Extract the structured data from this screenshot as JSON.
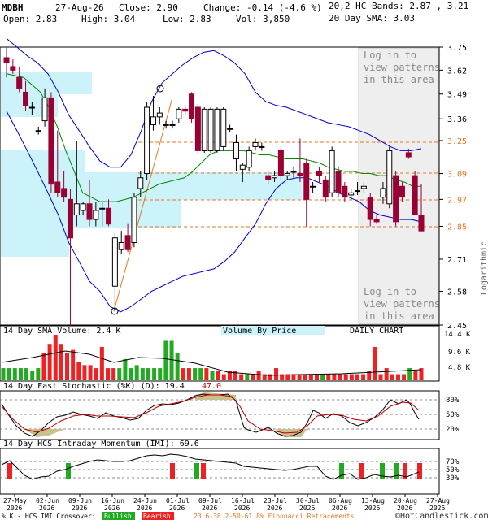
{
  "header": {
    "ticker": "MDBH",
    "date": "27-Aug-26",
    "close_label": "Close: 2.90",
    "change_label": "Change: -0.14 (-4.6 %)",
    "open_label": "Open: 2.83",
    "high_label": "High: 3.04",
    "low_label": "Low: 2.83",
    "vol_label": "Vol: 3,850",
    "bands_label": "20,2 HC Bands: 2.87 , 3.21",
    "sma_label": "20 Day SMA: 3.03",
    "bands_color": "#0000cc",
    "sma_color": "#008800"
  },
  "main_panel": {
    "patterns_note": [
      "Log in to",
      "view patterns",
      "in this area"
    ],
    "right_axis_title": "Logarithmic",
    "y_ticks": [
      "3.75",
      "3.62",
      "3.49",
      "3.36",
      "3.25",
      "3.09",
      "2.97",
      "2.85",
      "2.71",
      "2.58",
      "2.45"
    ],
    "highlight_ticks": [
      "3.25",
      "3.09",
      "2.97",
      "2.85"
    ],
    "fib_color": "#e87722"
  },
  "volume_panel": {
    "title": "14 Day SMA Volume: 2.4 K",
    "by_price_label": "Volume By Price",
    "daily_label": "DAILY CHART",
    "y_ticks": [
      "14.4 K",
      "9.6 K",
      "4.8 K"
    ]
  },
  "stoch_panel": {
    "title": "14 Day Fast Stochastic (%K) (D): 19.4",
    "d_value": "47.0",
    "y_ticks": [
      "80%",
      "50%",
      "20%"
    ]
  },
  "imi_panel": {
    "title": "14 Day HCS Intraday Momentum (IMI): 69.6",
    "y_ticks": [
      "70%",
      "50%",
      "30%"
    ]
  },
  "x_axis": {
    "labels": [
      [
        "27-May",
        "2026"
      ],
      [
        "02-Jun",
        "2026"
      ],
      [
        "09-Jun",
        "2026"
      ],
      [
        "16-Jun",
        "2026"
      ],
      [
        "24-Jun",
        "2026"
      ],
      [
        "01-Jul",
        "2026"
      ],
      [
        "09-Jul",
        "2026"
      ],
      [
        "16-Jul",
        "2026"
      ],
      [
        "23-Jul",
        "2026"
      ],
      [
        "30-Jul",
        "2026"
      ],
      [
        "06-Aug",
        "2026"
      ],
      [
        "13-Aug",
        "2026"
      ],
      [
        "20-Aug",
        "2026"
      ],
      [
        "27-Aug",
        "2026"
      ]
    ]
  },
  "footer": {
    "legend_label": "% K - HCS IMI Crossover:",
    "bullish_label": "Bullish",
    "bearish_label": "Bearish",
    "fib_label": "23.6-38.2-50-61.8% Fibonacci Retracements",
    "copyright": "©HotCandlestick.com",
    "bullish_color": "#22aa22",
    "bearish_color": "#ee2222"
  },
  "chart_data": {
    "type": "candlestick",
    "scale": "logarithmic",
    "ylim": [
      2.45,
      3.75
    ],
    "candles": [
      {
        "o": 3.69,
        "h": 3.75,
        "l": 3.58,
        "c": 3.66
      },
      {
        "o": 3.64,
        "h": 3.68,
        "l": 3.6,
        "c": 3.62
      },
      {
        "o": 3.58,
        "h": 3.64,
        "l": 3.5,
        "c": 3.52
      },
      {
        "o": 3.5,
        "h": 3.56,
        "l": 3.4,
        "c": 3.43
      },
      {
        "o": 3.42,
        "h": 3.45,
        "l": 3.38,
        "c": 3.42
      },
      {
        "o": 3.3,
        "h": 3.32,
        "l": 3.28,
        "c": 3.3
      },
      {
        "o": 3.35,
        "h": 3.52,
        "l": 3.32,
        "c": 3.47
      },
      {
        "o": 3.47,
        "h": 3.5,
        "l": 3.0,
        "c": 3.04
      },
      {
        "o": 3.05,
        "h": 3.3,
        "l": 2.98,
        "c": 3.0
      },
      {
        "o": 3.02,
        "h": 3.1,
        "l": 2.96,
        "c": 2.98
      },
      {
        "o": 2.97,
        "h": 3.02,
        "l": 2.38,
        "c": 2.8
      },
      {
        "o": 2.9,
        "h": 3.25,
        "l": 2.85,
        "c": 2.95
      },
      {
        "o": 2.92,
        "h": 2.96,
        "l": 2.9,
        "c": 2.95
      },
      {
        "o": 2.95,
        "h": 3.06,
        "l": 2.85,
        "c": 2.88
      },
      {
        "o": 2.88,
        "h": 2.96,
        "l": 2.85,
        "c": 2.92
      },
      {
        "o": 2.93,
        "h": 2.96,
        "l": 2.85,
        "c": 2.93
      },
      {
        "o": 2.93,
        "h": 2.97,
        "l": 2.85,
        "c": 2.86
      },
      {
        "o": 2.6,
        "h": 2.83,
        "l": 2.5,
        "c": 2.8
      },
      {
        "o": 2.75,
        "h": 2.83,
        "l": 2.73,
        "c": 2.78
      },
      {
        "o": 2.81,
        "h": 2.86,
        "l": 2.74,
        "c": 2.75
      },
      {
        "o": 2.78,
        "h": 3.0,
        "l": 2.76,
        "c": 2.98
      },
      {
        "o": 3.02,
        "h": 3.1,
        "l": 2.98,
        "c": 3.07
      },
      {
        "o": 3.09,
        "h": 3.45,
        "l": 3.06,
        "c": 3.42
      },
      {
        "o": 3.33,
        "h": 3.48,
        "l": 3.3,
        "c": 3.37
      },
      {
        "o": 3.37,
        "h": 3.42,
        "l": 3.33,
        "c": 3.39
      },
      {
        "o": 3.33,
        "h": 3.35,
        "l": 3.31,
        "c": 3.33
      },
      {
        "o": 3.33,
        "h": 3.35,
        "l": 3.31,
        "c": 3.33
      },
      {
        "o": 3.36,
        "h": 3.42,
        "l": 3.34,
        "c": 3.41
      },
      {
        "o": 3.41,
        "h": 3.43,
        "l": 3.38,
        "c": 3.4
      },
      {
        "o": 3.49,
        "h": 3.5,
        "l": 3.34,
        "c": 3.36
      },
      {
        "o": 3.42,
        "h": 3.44,
        "l": 3.18,
        "c": 3.2
      },
      {
        "o": 3.2,
        "h": 3.42,
        "l": 3.19,
        "c": 3.41
      },
      {
        "o": 3.2,
        "h": 3.42,
        "l": 3.19,
        "c": 3.41
      },
      {
        "o": 3.2,
        "h": 3.42,
        "l": 3.19,
        "c": 3.41
      },
      {
        "o": 3.22,
        "h": 3.42,
        "l": 3.2,
        "c": 3.41
      },
      {
        "o": 3.31,
        "h": 3.33,
        "l": 3.29,
        "c": 3.31
      },
      {
        "o": 3.16,
        "h": 3.28,
        "l": 3.1,
        "c": 3.24
      },
      {
        "o": 3.11,
        "h": 3.14,
        "l": 3.05,
        "c": 3.13
      },
      {
        "o": 3.12,
        "h": 3.22,
        "l": 3.1,
        "c": 3.2
      },
      {
        "o": 3.22,
        "h": 3.26,
        "l": 3.2,
        "c": 3.24
      },
      {
        "o": 3.22,
        "h": 3.24,
        "l": 3.2,
        "c": 3.22
      },
      {
        "o": 3.08,
        "h": 3.1,
        "l": 3.04,
        "c": 3.06
      },
      {
        "o": 3.07,
        "h": 3.1,
        "l": 3.05,
        "c": 3.08
      },
      {
        "o": 3.2,
        "h": 3.22,
        "l": 3.06,
        "c": 3.08
      },
      {
        "o": 3.08,
        "h": 3.1,
        "l": 3.06,
        "c": 3.09
      },
      {
        "o": 3.1,
        "h": 3.12,
        "l": 3.07,
        "c": 3.1
      },
      {
        "o": 3.09,
        "h": 3.26,
        "l": 3.05,
        "c": 3.08
      },
      {
        "o": 3.14,
        "h": 3.16,
        "l": 2.85,
        "c": 2.97
      },
      {
        "o": 3.03,
        "h": 3.05,
        "l": 3.0,
        "c": 3.03
      },
      {
        "o": 3.1,
        "h": 3.12,
        "l": 3.05,
        "c": 3.08
      },
      {
        "o": 3.06,
        "h": 3.08,
        "l": 2.96,
        "c": 2.98
      },
      {
        "o": 3.0,
        "h": 3.22,
        "l": 2.98,
        "c": 3.2
      },
      {
        "o": 3.1,
        "h": 3.12,
        "l": 2.98,
        "c": 3.0
      },
      {
        "o": 3.03,
        "h": 3.05,
        "l": 2.96,
        "c": 2.98
      },
      {
        "o": 2.99,
        "h": 3.02,
        "l": 2.97,
        "c": 3.0
      },
      {
        "o": 3.01,
        "h": 3.05,
        "l": 2.99,
        "c": 3.01
      },
      {
        "o": 3.02,
        "h": 3.05,
        "l": 3.0,
        "c": 3.03
      },
      {
        "o": 2.98,
        "h": 3.0,
        "l": 2.85,
        "c": 2.88
      },
      {
        "o": 2.88,
        "h": 2.9,
        "l": 2.86,
        "c": 2.87
      },
      {
        "o": 2.98,
        "h": 3.05,
        "l": 2.95,
        "c": 3.02
      },
      {
        "o": 2.95,
        "h": 3.22,
        "l": 2.93,
        "c": 3.2
      },
      {
        "o": 3.08,
        "h": 3.1,
        "l": 2.85,
        "c": 2.87
      },
      {
        "o": 3.03,
        "h": 3.05,
        "l": 2.96,
        "c": 2.98
      },
      {
        "o": 3.19,
        "h": 3.21,
        "l": 3.16,
        "c": 3.17
      },
      {
        "o": 3.08,
        "h": 3.1,
        "l": 2.91,
        "c": 2.9
      },
      {
        "o": 2.9,
        "h": 3.04,
        "l": 2.83,
        "c": 2.83
      }
    ],
    "sma20": [
      3.6,
      3.59,
      3.58,
      3.54,
      3.5,
      3.42,
      3.32,
      3.2,
      3.1,
      3.0,
      2.98,
      2.96,
      2.96,
      2.96,
      2.97,
      2.98,
      3.0,
      3.02,
      3.04,
      3.05,
      3.06,
      3.07,
      3.1,
      3.14,
      3.18,
      3.2,
      3.2,
      3.2,
      3.2,
      3.19,
      3.18,
      3.18,
      3.17,
      3.16,
      3.16,
      3.16,
      3.15,
      3.14,
      3.12,
      3.11,
      3.1,
      3.1,
      3.09,
      3.09,
      3.08,
      3.08,
      3.06,
      3.05,
      3.03,
      3.03
    ],
    "bb_upper": [
      3.8,
      3.75,
      3.7,
      3.66,
      3.6,
      3.5,
      3.38,
      3.3,
      3.22,
      3.15,
      3.12,
      3.12,
      3.18,
      3.3,
      3.45,
      3.55,
      3.6,
      3.65,
      3.69,
      3.72,
      3.73,
      3.7,
      3.66,
      3.6,
      3.5,
      3.45,
      3.43,
      3.42,
      3.4,
      3.38,
      3.36,
      3.34,
      3.33,
      3.32,
      3.3,
      3.28,
      3.25,
      3.22,
      3.2,
      3.2,
      3.21
    ],
    "bb_lower": [
      3.4,
      3.3,
      3.2,
      3.1,
      3.0,
      2.9,
      2.78,
      2.7,
      2.62,
      2.58,
      2.52,
      2.5,
      2.52,
      2.55,
      2.58,
      2.6,
      2.62,
      2.64,
      2.65,
      2.66,
      2.67,
      2.7,
      2.74,
      2.8,
      2.86,
      2.95,
      3.02,
      3.06,
      3.07,
      3.07,
      3.05,
      3.03,
      3.0,
      2.98,
      2.96,
      2.92,
      2.9,
      2.89,
      2.88,
      2.88,
      2.87
    ]
  }
}
